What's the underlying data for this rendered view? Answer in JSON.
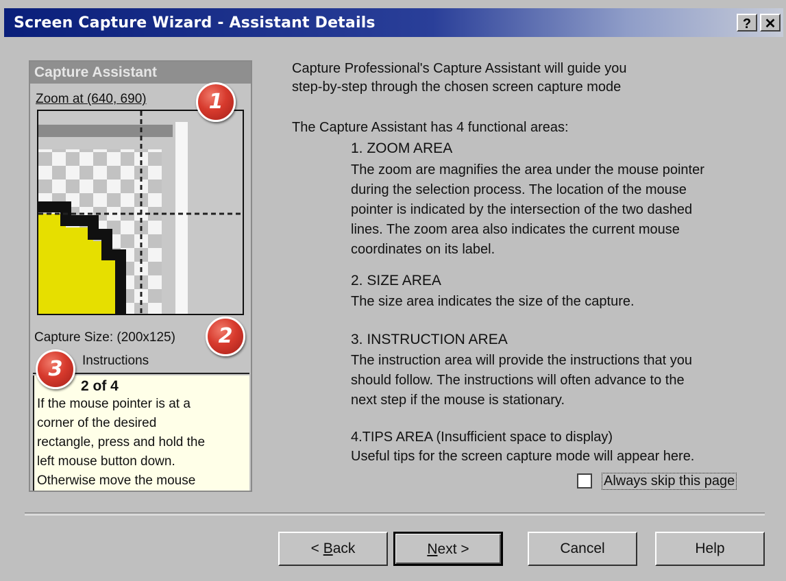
{
  "window": {
    "title": "Screen Capture Wizard - Assistant Details",
    "help_label": "?",
    "close_label": "✕"
  },
  "assistant": {
    "header": "Capture Assistant",
    "zoom_label": "Zoom at (640, 690)",
    "size_label": "Capture Size: (200x125)",
    "instructions_label": "Instructions",
    "step": "2 of 4",
    "instruction_lines": [
      "If the mouse pointer is at a",
      "corner of the desired",
      "rectangle, press and hold the",
      "left mouse button down.",
      "Otherwise move the mouse"
    ]
  },
  "badges": [
    "1",
    "2",
    "3"
  ],
  "description": {
    "intro_line1": "Capture Professional's Capture Assistant will guide you",
    "intro_line2": "step-by-step through the chosen screen capture mode",
    "areas_intro": "The Capture Assistant has 4 functional areas:",
    "area1_title": "1. ZOOM AREA",
    "area1_lines": [
      "The zoom are magnifies the area under the mouse pointer",
      "during the selection process.  The location of the mouse",
      "pointer is indicated by the intersection of the two dashed",
      "lines. The zoom area also indicates the current mouse",
      "coordinates on its label."
    ],
    "area2_title": "2. SIZE AREA",
    "area2_line": "The size area indicates the size of the capture.",
    "area3_title": "3. INSTRUCTION AREA",
    "area3_lines": [
      "The instruction area will provide the instructions that you",
      "should follow.  The instructions will often advance to the",
      "next step if the mouse is stationary."
    ],
    "area4_title": "4.TIPS AREA (Insufficient space to display)",
    "area4_line": "Useful tips for the screen capture mode will appear here."
  },
  "checkbox": {
    "label": "Always skip this page",
    "checked": false
  },
  "buttons": {
    "back": {
      "prefix": "< ",
      "accel": "B",
      "rest": "ack"
    },
    "next": {
      "accel": "N",
      "rest": "ext >"
    },
    "cancel": "Cancel",
    "help": "Help"
  },
  "colors": {
    "title_gradient_start": "#0a1f7a",
    "badge": "#d73a2d",
    "zoom_yellow": "#e8e000",
    "dialog_bg": "#bfbfbf"
  }
}
